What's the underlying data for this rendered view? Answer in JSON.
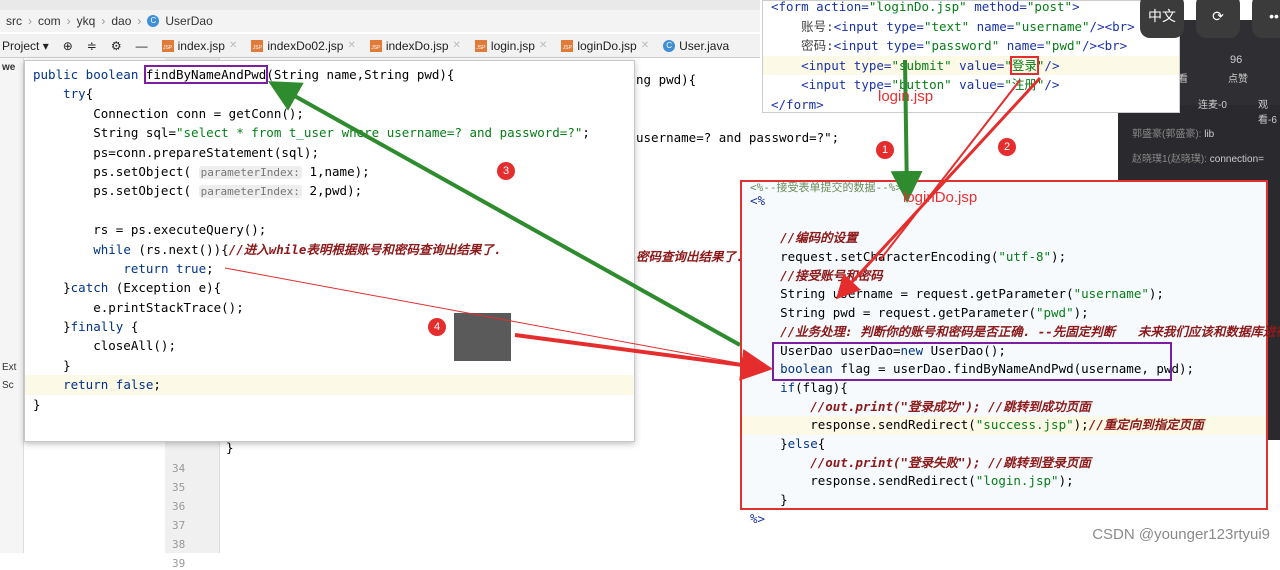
{
  "breadcrumb": [
    "src",
    "com",
    "ykq",
    "dao",
    "UserDao"
  ],
  "toolbar": {
    "project_label": "Project",
    "tabs": [
      "index.jsp",
      "indexDo02.jsp",
      "indexDo.jsp",
      "login.jsp",
      "loginDo.jsp",
      "User.java"
    ]
  },
  "sidebar": {
    "items": [
      "we",
      "Ext",
      "Sc"
    ]
  },
  "gutter": {
    "line_numbers": [
      "34",
      "35",
      "36",
      "37",
      "38",
      "39"
    ]
  },
  "background_code": {
    "l1": "ng pwd){",
    "l2": "username=? and password=?\";",
    "l3": "密码查询出结果了.",
    "l4": "}"
  },
  "popup_code": [
    [
      [
        "kw",
        "public boolean "
      ],
      [
        "pl boxed",
        "findByNameAndPwd"
      ],
      [
        "pl",
        "(String name,String pwd){"
      ]
    ],
    [
      [
        "pl",
        "    "
      ],
      [
        "kw",
        "try"
      ],
      [
        "pl",
        "{"
      ]
    ],
    [
      [
        "pl",
        "        Connection conn = getConn();"
      ]
    ],
    [
      [
        "pl",
        "        String sql="
      ],
      [
        "str",
        "\"select * from t_user where username=? and password=?\""
      ],
      [
        "pl",
        ";"
      ]
    ],
    [
      [
        "pl",
        "        ps=conn.prepareStatement(sql);"
      ]
    ],
    [
      [
        "pl",
        "        ps.setObject( "
      ],
      [
        "hint",
        "parameterIndex:"
      ],
      [
        "pl",
        " 1,name);"
      ]
    ],
    [
      [
        "pl",
        "        ps.setObject( "
      ],
      [
        "hint",
        "parameterIndex:"
      ],
      [
        "pl",
        " 2,pwd);"
      ]
    ],
    [
      [
        "pl",
        ""
      ]
    ],
    [
      [
        "pl",
        "        rs = ps.executeQuery();"
      ]
    ],
    [
      [
        "pl",
        "        "
      ],
      [
        "kw",
        "while"
      ],
      [
        "pl",
        " (rs.next()){"
      ],
      [
        "cm",
        "//进入while表明根据账号和密码查询出结果了."
      ]
    ],
    [
      [
        "pl",
        "            "
      ],
      [
        "kw",
        "return true"
      ],
      [
        "pl",
        ";"
      ]
    ],
    [
      [
        "pl",
        "    }"
      ],
      [
        "kw",
        "catch"
      ],
      [
        "pl",
        " (Exception e){"
      ]
    ],
    [
      [
        "pl",
        "        e.printStackTrace();"
      ]
    ],
    [
      [
        "pl",
        "    }"
      ],
      [
        "kw",
        "finally"
      ],
      [
        "pl",
        " {"
      ]
    ],
    [
      [
        "pl",
        "        closeAll();"
      ]
    ],
    [
      [
        "pl",
        "    }"
      ]
    ],
    [
      [
        "pl",
        "    "
      ],
      [
        "kw",
        "return false"
      ],
      [
        "pl",
        ";"
      ]
    ],
    [
      [
        "pl",
        "}"
      ]
    ]
  ],
  "login_code": [
    [
      [
        "tag",
        "<form "
      ],
      [
        "att",
        "action="
      ],
      [
        "str",
        "\"loginDo.jsp\""
      ],
      [
        "att",
        " method="
      ],
      [
        "str",
        "\"post\""
      ],
      [
        "tag",
        ">"
      ]
    ],
    [
      [
        "tx",
        "    账号:"
      ],
      [
        "tag",
        "<input "
      ],
      [
        "att",
        "type="
      ],
      [
        "str",
        "\"text\""
      ],
      [
        "att",
        " name="
      ],
      [
        "str",
        "\"username\""
      ],
      [
        "tag",
        "/><br>"
      ]
    ],
    [
      [
        "tx",
        "    密码:"
      ],
      [
        "tag",
        "<input "
      ],
      [
        "att",
        "type="
      ],
      [
        "str",
        "\"password\""
      ],
      [
        "att",
        " name="
      ],
      [
        "str",
        "\"pwd\""
      ],
      [
        "tag",
        "/><br>"
      ]
    ],
    [
      [
        "tag",
        "    <input "
      ],
      [
        "att",
        "type="
      ],
      [
        "str",
        "\"submit\""
      ],
      [
        "att",
        " value="
      ],
      [
        "str",
        "\""
      ],
      [
        "str boxred",
        "登录"
      ],
      [
        "str",
        "\""
      ],
      [
        "tag",
        "/>"
      ]
    ],
    [
      [
        "tag",
        "    <input "
      ],
      [
        "att",
        "type="
      ],
      [
        "str",
        "\"button\""
      ],
      [
        "att",
        " value="
      ],
      [
        "str",
        "\"注册\""
      ],
      [
        "tag",
        "/>"
      ]
    ],
    [
      [
        "tag",
        "</form>"
      ]
    ]
  ],
  "logindo_code": [
    [
      [
        "tag",
        "<%"
      ]
    ],
    [
      [
        "pl",
        ""
      ]
    ],
    [
      [
        "cm",
        "    //编码的设置"
      ]
    ],
    [
      [
        "pl",
        "    request.setCharacterEncoding("
      ],
      [
        "str",
        "\"utf-8\""
      ],
      [
        "pl",
        ");"
      ]
    ],
    [
      [
        "cm",
        "    //接受账号和密码"
      ]
    ],
    [
      [
        "pl",
        "    String username = request.getParameter("
      ],
      [
        "str",
        "\"username\""
      ],
      [
        "pl",
        ");"
      ]
    ],
    [
      [
        "pl",
        "    String pwd = request.getParameter("
      ],
      [
        "str",
        "\"pwd\""
      ],
      [
        "pl",
        ");"
      ]
    ],
    [
      [
        "cm",
        "    //业务处理: 判断你的账号和密码是否正确. --先固定判断   未来我们应该和数据库进行比对."
      ]
    ],
    [
      [
        "pl",
        "    UserDao userDao="
      ],
      [
        "kw",
        "new"
      ],
      [
        "pl",
        " UserDao();"
      ]
    ],
    [
      [
        "kw",
        "    boolean"
      ],
      [
        "pl",
        " flag = userDao.findByNameAndPwd(username, pwd);"
      ]
    ],
    [
      [
        "kw",
        "    if"
      ],
      [
        "pl",
        "(flag){"
      ]
    ],
    [
      [
        "cm",
        "        //out.print(\"登录成功\"); //跳转到成功页面"
      ]
    ],
    [
      [
        "pl",
        "        response.sendRedirect("
      ],
      [
        "str",
        "\"success.jsp\""
      ],
      [
        "pl",
        ");"
      ],
      [
        "cm",
        "//重定向到指定页面"
      ]
    ],
    [
      [
        "pl",
        "    }"
      ],
      [
        "kw",
        "else"
      ],
      [
        "pl",
        "{"
      ]
    ],
    [
      [
        "cm",
        "        //out.print(\"登录失败\"); //跳转到登录页面"
      ]
    ],
    [
      [
        "pl",
        "        response.sendRedirect("
      ],
      [
        "str",
        "\"login.jsp\""
      ],
      [
        "pl",
        ");"
      ]
    ],
    [
      [
        "pl",
        "    }"
      ]
    ],
    [
      [
        "tag",
        "%>"
      ]
    ]
  ],
  "logindo_header_comment": "<%--接受表单提交的数据--%>",
  "annotations": {
    "login_label": "login.jsp",
    "logindo_label": "loginDo.jsp",
    "steps": [
      "1",
      "2",
      "3",
      "4"
    ]
  },
  "dark_panel": {
    "count": "96",
    "count_label": "点赞",
    "left_label": "观看",
    "tab1": "连麦-0",
    "tab2": "观看-6",
    "msg1_user": "郭盛豪(郭盛豪):",
    "msg1_text": "lib",
    "msg2_user": "赵晓璞1(赵晓璞):",
    "msg2_text": "connection="
  },
  "tools": {
    "translate": "中文",
    "rotate": "⟳",
    "more": "••"
  },
  "watermark": "CSDN @younger123rtyui9",
  "colors": {
    "annotation_red": "#e52d2d",
    "arrow_green": "#2e8b2e",
    "highlight_purple": "#7a1fa0"
  }
}
